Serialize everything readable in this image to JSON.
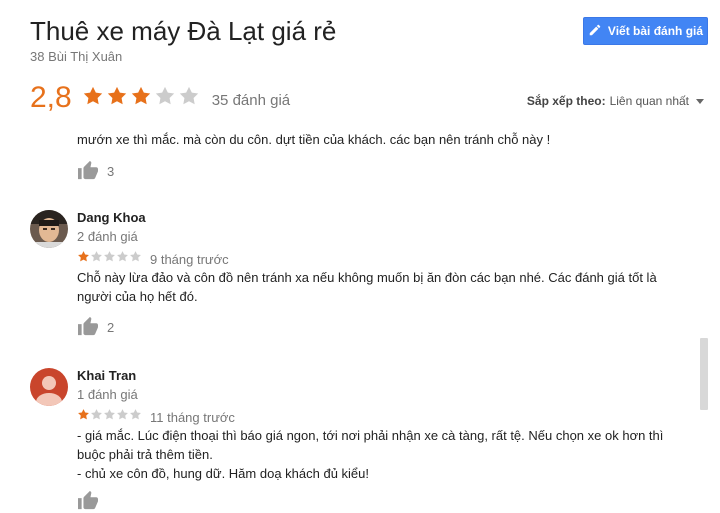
{
  "header": {
    "title": "Thuê xe máy Đà Lạt giá rẻ",
    "address": "38 Bùi Thị Xuân",
    "write_review_label": "Viết bài đánh giá"
  },
  "rating": {
    "value": "2,8",
    "stars": 3,
    "count_label": "35 đánh giá"
  },
  "sort": {
    "label": "Sắp xếp theo:",
    "value": "Liên quan nhất"
  },
  "reviews": [
    {
      "text_partial": "mướn xe thì mắc. mà còn du côn. dựt tiền của khách. các bạn nên tránh chỗ này !",
      "likes": "3"
    },
    {
      "name": "Dang Khoa",
      "review_count": "2 đánh giá",
      "stars": 1,
      "time": "9 tháng trước",
      "text_line1": "Chỗ này lừa đảo và côn đồ nên tránh xa nếu không muốn bị ăn đòn các bạn nhé. Các đánh giá tốt là",
      "text_line2": "người của họ hết đó.",
      "likes": "2"
    },
    {
      "name": "Khai Tran",
      "review_count": "1 đánh giá",
      "stars": 1,
      "time": "11 tháng trước",
      "text_line1": "- giá mắc. Lúc điện thoại thì báo giá ngon, tới nơi phải nhận xe cà tàng, rất tệ. Nếu chọn xe ok hơn thì",
      "text_line2": "buộc phải trả thêm tiền.",
      "text_line3": "- chủ xe côn đồ, hung dữ. Hăm doạ khách đủ kiểu!"
    }
  ],
  "colors": {
    "star": "#e7711b",
    "star_empty": "#ccc",
    "button": "#4285f4"
  }
}
